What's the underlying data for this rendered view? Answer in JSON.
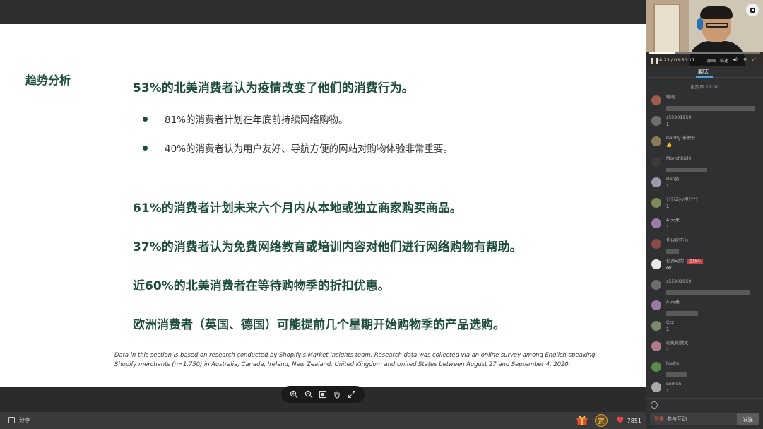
{
  "slide": {
    "section_title": "趋势分析",
    "headlines": [
      "53%的北美消费者认为疫情改变了他们的消费行为。",
      "61%的消费者计划未来六个月内从本地或独立商家购买商品。",
      "37%的消费者认为免费网络教育或培训内容对他们进行网络购物有帮助。",
      "近60%的北美消费者在等待购物季的折扣优惠。",
      "欧洲消费者（英国、德国）可能提前几个星期开始购物季的产品选购。"
    ],
    "bullets": [
      "81%的消费者计划在年底前持续网络购物。",
      "40%的消费者认为用户友好、导航方便的网站对购物体验非常重要。"
    ],
    "footnote": "Data in this section is based on research conducted by Shopify's Market Insights team. Research data was collected via an online survey among English-speaking Shopify merchants (n=1,750) in Australia, Canada, Ireland, New Zealand, United Kingdom and United States between August 27 and September 4, 2020."
  },
  "zoombar": {
    "icons": [
      "zoom-in-icon",
      "zoom-out-icon",
      "fit-icon",
      "hand-icon",
      "fullscreen-icon"
    ]
  },
  "bottombar": {
    "share_label": "分享",
    "reward_label": "赏",
    "likes_count": "7851"
  },
  "player": {
    "time": "48:23 / 03:30:17",
    "progress": 0.23,
    "controls": [
      "原画",
      "倍速"
    ]
  },
  "panel": {
    "tab_chat": "聊天",
    "chat_time": "星期四 17:00"
  },
  "chat": [
    {
      "name": "哈哈",
      "text": "",
      "blur": 125
    },
    {
      "name": "s55901959",
      "text": "1",
      "blur": 0
    },
    {
      "name": "Gabby 米卿安",
      "text": "👍",
      "blur": 0
    },
    {
      "name": "Monchhichi",
      "text": "",
      "blur": 58
    },
    {
      "name": "Ben龚",
      "text": "1",
      "blur": 0
    },
    {
      "name": "????Zyy橙????",
      "text": "1",
      "blur": 0
    },
    {
      "name": "A 未来",
      "text": "1",
      "blur": 0
    },
    {
      "name": "何以纪不仙",
      "text": "",
      "blur": 18
    },
    {
      "name": "亿邦动力",
      "badge": "主持人",
      "text": "ok",
      "blur": 0
    },
    {
      "name": "s55901959",
      "text": "",
      "blur": 118
    },
    {
      "name": "A 未来",
      "text": "",
      "blur": 45
    },
    {
      "name": "Czz",
      "text": "1",
      "blur": 0
    },
    {
      "name": "彩虹的微笑",
      "text": "1",
      "blur": 0
    },
    {
      "name": "hudro",
      "text": "",
      "blur": 30
    },
    {
      "name": "Lemon",
      "text": "1",
      "blur": 0
    }
  ],
  "input": {
    "login": "登录",
    "placeholder": "参与互动",
    "send_label": "发送"
  },
  "colors": {
    "slide_green": "#1f4d3c",
    "accent_blue": "#4aa0e6",
    "heart": "#e8424a"
  }
}
